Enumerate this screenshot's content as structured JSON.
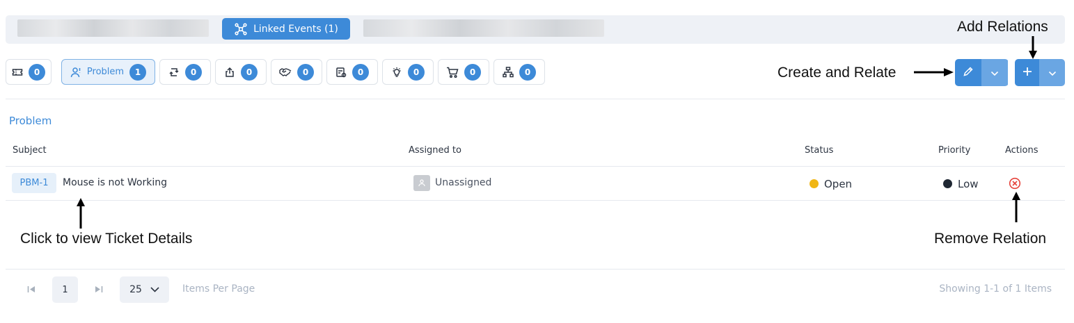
{
  "top_tabs": {
    "linked_events_label": "Linked Events (1)"
  },
  "filter_chips": [
    {
      "icon": "ticket-icon",
      "count": "0"
    },
    {
      "icon": "problem-user-icon",
      "label": "Problem",
      "count": "1",
      "active": true
    },
    {
      "icon": "change-icon",
      "count": "0"
    },
    {
      "icon": "release-icon",
      "count": "0"
    },
    {
      "icon": "handshake-icon",
      "count": "0"
    },
    {
      "icon": "asset-icon",
      "count": "0"
    },
    {
      "icon": "lightbulb-icon",
      "count": "0"
    },
    {
      "icon": "cart-icon",
      "count": "0"
    },
    {
      "icon": "hierarchy-icon",
      "count": "0"
    }
  ],
  "annotations": {
    "add_relations": "Add Relations",
    "create_and_relate": "Create and Relate",
    "click_ticket": "Click to view Ticket Details",
    "remove_relation": "Remove Relation"
  },
  "section": {
    "title": "Problem"
  },
  "table": {
    "headers": {
      "subject": "Subject",
      "assigned_to": "Assigned to",
      "status": "Status",
      "priority": "Priority",
      "actions": "Actions"
    },
    "rows": [
      {
        "id": "PBM-1",
        "subject": "Mouse is not Working",
        "assigned_to": "Unassigned",
        "status": "Open",
        "priority": "Low"
      }
    ]
  },
  "pagination": {
    "page": "1",
    "page_size": "25",
    "items_per_page_label": "Items Per Page",
    "summary": "Showing 1-1 of 1 Items"
  },
  "colors": {
    "accent": "#3d8ad8",
    "accent_light": "#6aa6e3",
    "status_open": "#f0b614",
    "priority_low": "#1f2733",
    "remove": "#e5423a"
  }
}
